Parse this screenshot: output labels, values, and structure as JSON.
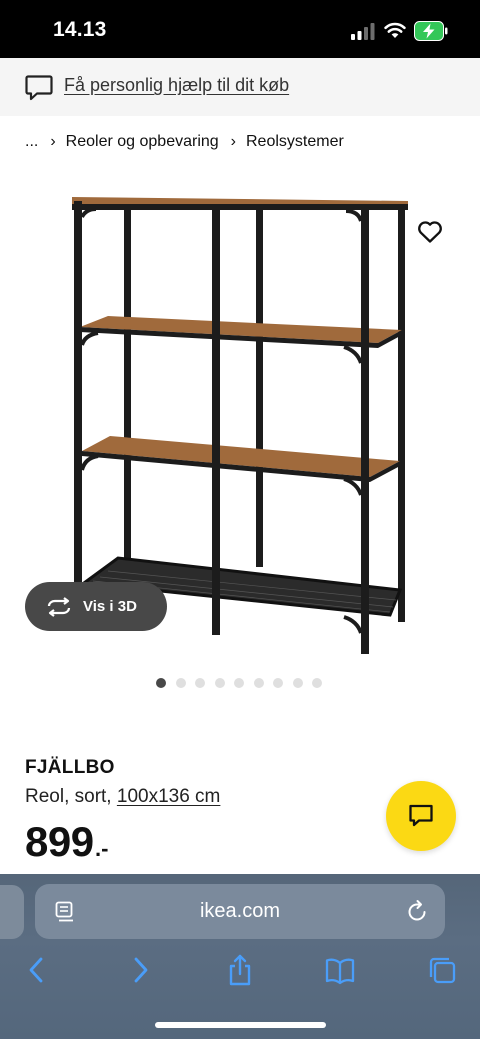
{
  "status_bar": {
    "time": "14.13"
  },
  "help_banner": {
    "text": "Få personlig hjælp til dit køb"
  },
  "breadcrumb": {
    "ellipsis": "...",
    "items": [
      "Reoler og opbevaring",
      "Reolsystemer"
    ]
  },
  "gallery": {
    "view_3d_label": "Vis i 3D",
    "image_count": 9,
    "active_index": 0
  },
  "product": {
    "name": "FJÄLLBO",
    "description_prefix": "Reol, sort, ",
    "dimensions": "100x136 cm",
    "price": "899",
    "price_suffix": ".-"
  },
  "browser": {
    "url": "ikea.com"
  },
  "colors": {
    "accent_yellow": "#fbd914",
    "wood": "#a06a3c",
    "frame": "#1c1c1c"
  }
}
